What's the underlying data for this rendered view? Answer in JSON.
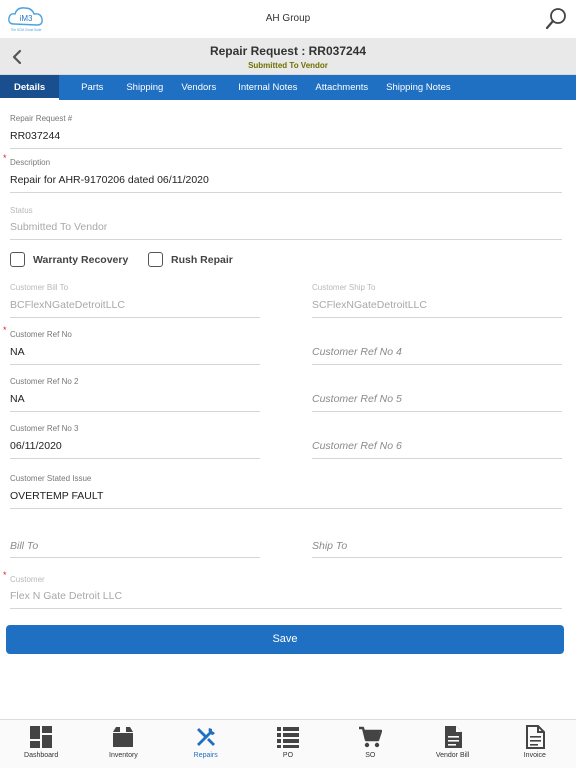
{
  "app": {
    "logo_text": "iM3",
    "logo_subtext": "The SCM Cloud Suite",
    "company": "AH Group"
  },
  "header": {
    "title": "Repair Request : RR037244",
    "status": "Submitted To Vendor"
  },
  "tabs": [
    {
      "label": "Details"
    },
    {
      "label": "Parts"
    },
    {
      "label": "Shipping"
    },
    {
      "label": "Vendors"
    },
    {
      "label": "Internal Notes"
    },
    {
      "label": "Attachments"
    },
    {
      "label": "Shipping Notes"
    }
  ],
  "form": {
    "repair_request_no": {
      "label": "Repair Request #",
      "value": "RR037244"
    },
    "description": {
      "label": "Description",
      "value": "Repair for AHR-9170206 dated 06/11/2020"
    },
    "status": {
      "label": "Status",
      "value": "Submitted To Vendor"
    },
    "warranty_recovery": {
      "label": "Warranty Recovery",
      "checked": false
    },
    "rush_repair": {
      "label": "Rush Repair",
      "checked": false
    },
    "customer_bill_to": {
      "label": "Customer Bill To",
      "value": "BCFlexNGateDetroitLLC"
    },
    "customer_ship_to": {
      "label": "Customer Ship To",
      "value": "SCFlexNGateDetroitLLC"
    },
    "customer_ref_no": {
      "label": "Customer Ref No",
      "value": "NA"
    },
    "customer_ref_no_2": {
      "label": "Customer Ref No 2",
      "value": "NA"
    },
    "customer_ref_no_3": {
      "label": "Customer Ref No 3",
      "value": "06/11/2020"
    },
    "customer_ref_no_4": {
      "placeholder": "Customer Ref No 4"
    },
    "customer_ref_no_5": {
      "placeholder": "Customer Ref No 5"
    },
    "customer_ref_no_6": {
      "placeholder": "Customer Ref No 6"
    },
    "customer_stated_issue": {
      "label": "Customer Stated Issue",
      "value": "OVERTEMP FAULT"
    },
    "bill_to": {
      "placeholder": "Bill To"
    },
    "ship_to": {
      "placeholder": "Ship To"
    },
    "customer": {
      "label": "Customer",
      "value": "Flex N Gate Detroit LLC"
    },
    "required_marker": "*",
    "save_label": "Save"
  },
  "bottom_nav": [
    {
      "label": "Dashboard",
      "icon": "dashboard-icon"
    },
    {
      "label": "Inventory",
      "icon": "box-icon"
    },
    {
      "label": "Repairs",
      "icon": "tools-icon",
      "active": true
    },
    {
      "label": "PO",
      "icon": "list-icon"
    },
    {
      "label": "SO",
      "icon": "cart-icon"
    },
    {
      "label": "Vendor Bill",
      "icon": "document-icon"
    },
    {
      "label": "Invoice",
      "icon": "invoice-icon"
    }
  ],
  "colors": {
    "accent": "#1f6fc3",
    "active_tab": "#1a4f8f",
    "status_text": "#707000",
    "required": "#e0202a"
  }
}
